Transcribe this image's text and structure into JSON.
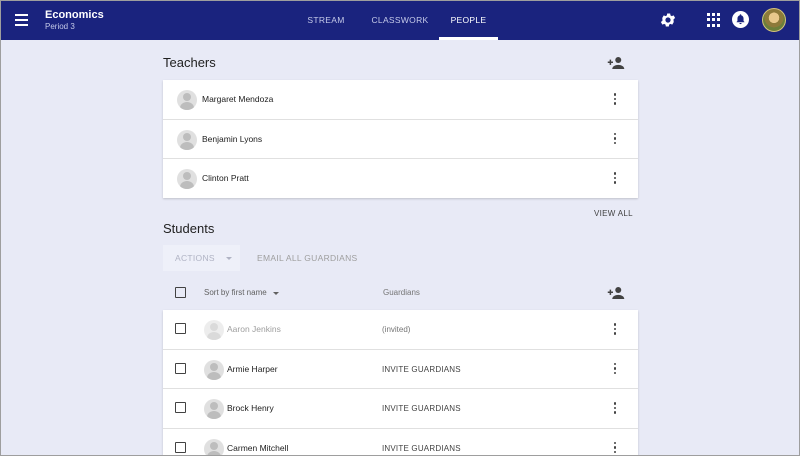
{
  "header": {
    "class_name": "Economics",
    "class_section": "Period 3",
    "tabs": [
      {
        "label": "STREAM"
      },
      {
        "label": "CLASSWORK"
      },
      {
        "label": "PEOPLE",
        "active": true
      }
    ],
    "icons": [
      "menu-icon",
      "gear-icon",
      "apps-icon",
      "bell-icon"
    ],
    "bar_color": "#1a237e"
  },
  "teachers": {
    "title": "Teachers",
    "list": [
      {
        "name": "Margaret Mendoza"
      },
      {
        "name": "Benjamin Lyons"
      },
      {
        "name": "Clinton Pratt"
      }
    ],
    "view_all": "VIEW ALL"
  },
  "students": {
    "title": "Students",
    "actions_label": "ACTIONS",
    "email_guardians_label": "EMAIL ALL GUARDIANS",
    "sort_label": "Sort by first name",
    "guardians_header": "Guardians",
    "list": [
      {
        "name": "Aaron Jenkins",
        "guardians": "(invited)",
        "invited": true
      },
      {
        "name": "Armie Harper",
        "guardians": "INVITE GUARDIANS"
      },
      {
        "name": "Brock Henry",
        "guardians": "INVITE GUARDIANS"
      },
      {
        "name": "Carmen Mitchell",
        "guardians": "INVITE GUARDIANS"
      }
    ]
  }
}
